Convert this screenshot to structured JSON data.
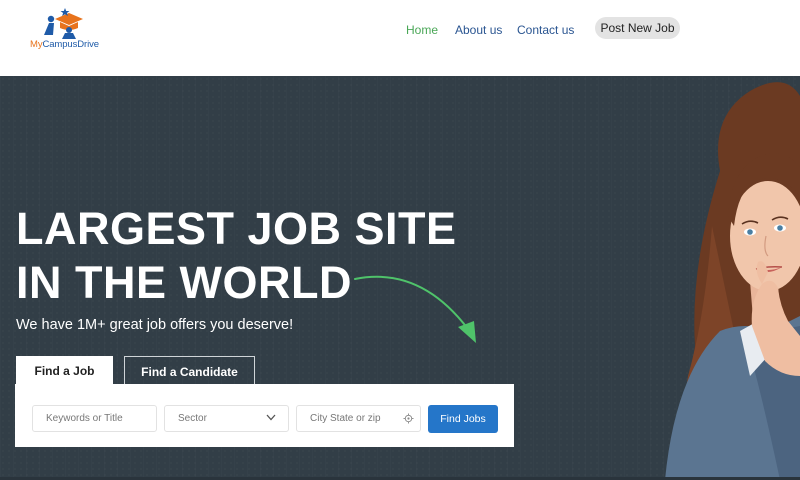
{
  "brand": {
    "logo_my": "My",
    "logo_campus": "Campus",
    "logo_drive": "Drive",
    "colors": {
      "orange": "#e8731c",
      "blue": "#1f5ba8"
    }
  },
  "nav": {
    "home": "Home",
    "about": "About us",
    "contact": "Contact us",
    "post_job": "Post New Job",
    "active": "Home",
    "active_color": "#4aa757"
  },
  "hero": {
    "headline_line1": "LARGEST JOB SITE",
    "headline_line2": "IN THE WORLD",
    "subline": "We have 1M+ great job offers you deserve!",
    "background_color": "#323e47",
    "arrow_color": "#4fc36a"
  },
  "tabs": {
    "find_job": "Find a Job",
    "find_candidate": "Find a Candidate",
    "active": "Find a Job"
  },
  "search": {
    "keywords_placeholder": "Keywords or Title",
    "sector_value": "Sector",
    "city_placeholder": "City State or zip",
    "button": "Find Jobs",
    "button_color": "#2576c9",
    "icons": {
      "sector": "chevron-down-icon",
      "city": "location-target-icon"
    }
  }
}
